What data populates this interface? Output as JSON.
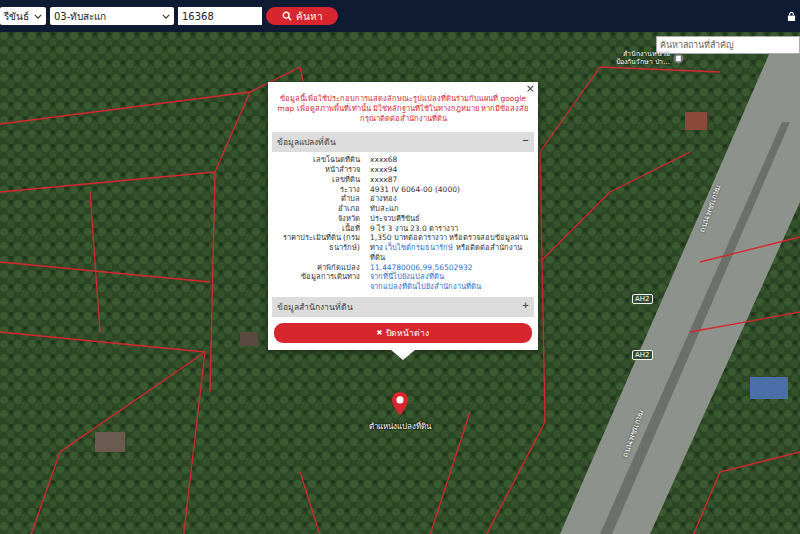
{
  "toolbar": {
    "province": "รีขันธ์",
    "district": "03-ทับสะแก",
    "parcel_number": "16368",
    "search_button": "ค้นหา"
  },
  "map": {
    "place_search": {
      "placeholder": "ค้นหาสถานที่สำคัญ"
    },
    "poi_lines": [
      "สำนักงานหน่วย",
      "ป้องกันรักษา ป่า..."
    ],
    "road_labels": [
      "ถนนเพชรเกษม",
      "ถนนเพชรเกษม"
    ],
    "highway_shields": [
      "AH2",
      "AH2"
    ],
    "marker_label": "ตำแหน่งแปลงที่ดิน"
  },
  "popup": {
    "close": "×",
    "warning": "ข้อมูลนี้เพื่อใช้ประกอบการแสดงลักษณะรูปแปลงที่ดินร่วมกับแผนที่ google map เพื่อดูสภาพพื้นที่เท่านั้น มิใช่หลักฐานที่ใช้ในทางกฎหมาย หากมีข้อสงสัย กรุณาติดต่อสำนักงานที่ดิน",
    "sections": [
      {
        "title": "ข้อมูลแปลงที่ดิน",
        "toggle": "−",
        "expanded": true,
        "rows": [
          {
            "label": "เลขโฉนดที่ดิน",
            "value": [
              {
                "text": "xxxx68",
                "link": false
              }
            ]
          },
          {
            "label": "หน้าสำรวจ",
            "value": [
              {
                "text": "xxxx94",
                "link": false
              }
            ]
          },
          {
            "label": "เลขที่ดิน",
            "value": [
              {
                "text": "xxxx87",
                "link": false
              }
            ]
          },
          {
            "label": "ระวาง",
            "value": [
              {
                "text": "4931 IV 6064-00 (4000)",
                "link": false
              }
            ]
          },
          {
            "label": "ตำบล",
            "value": [
              {
                "text": "อ่างทอง",
                "link": false
              }
            ]
          },
          {
            "label": "อำเภอ",
            "value": [
              {
                "text": "ทับสะแก",
                "link": false
              }
            ]
          },
          {
            "label": "จังหวัด",
            "value": [
              {
                "text": "ประจวบคีรีขันธ์",
                "link": false
              }
            ]
          },
          {
            "label": "เนื้อที่",
            "value": [
              {
                "text": "9 ไร่ 3 งาน 23.0 ตารางวา",
                "link": false
              }
            ]
          },
          {
            "label": "ราคาประเมินที่ดิน (กรมธนารักษ์)",
            "value": [
              {
                "text": "1,350 บาทต่อตารางวา หรือตรวจสอบข้อมูลผ่านทาง ",
                "link": false
              },
              {
                "text": "เว็บไซต์กรมธนารักษ์",
                "link": true
              },
              {
                "text": " หรือติดต่อสำนักงานที่ดิน",
                "link": false
              }
            ]
          },
          {
            "label": "ค่าพิกัดแปลง",
            "value": [
              {
                "text": "11.44780006,99.56502932",
                "link": true
              }
            ]
          },
          {
            "label": "ข้อมูลการเดินทาง",
            "value": [
              {
                "text": "จากที่นี่ไปยังแปลงที่ดิน",
                "link": true
              },
              {
                "text": "จากแปลงที่ดินไปยังสำนักงานที่ดิน",
                "link": true
              }
            ]
          }
        ]
      },
      {
        "title": "ข้อมูลสำนักงานที่ดิน",
        "toggle": "+",
        "expanded": false,
        "rows": []
      }
    ],
    "close_button": {
      "icon": "✖",
      "label": "ปิดหน้าต่าง"
    }
  }
}
